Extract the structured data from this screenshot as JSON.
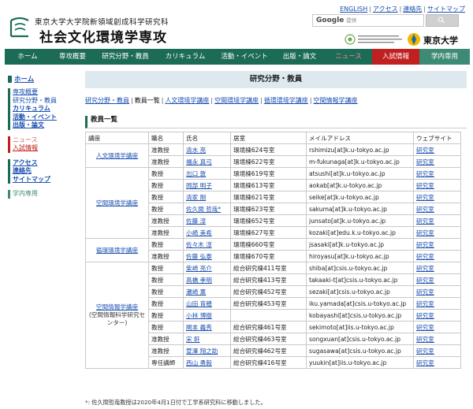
{
  "header": {
    "university": "東京大学大学院新領域創成科学研究科",
    "department": "社会文化環境学専攻",
    "top_links": [
      "ENGLISH",
      "アクセス",
      "連絡先",
      "サイトマップ"
    ],
    "search_brand": "Google",
    "search_sub": "提供",
    "ut_name": "東京大学"
  },
  "nav": {
    "items": [
      "ホーム",
      "専攻概要",
      "研究分野・教員",
      "カリキュラム",
      "活動・イベント",
      "出版・論文",
      "ニュース",
      "入試情報",
      "学内専用"
    ]
  },
  "sidebar": {
    "home": "ホーム",
    "group1": [
      "専攻概要",
      "研究分野・教員",
      "カリキュラム",
      "活動・イベント",
      "出版・論文"
    ],
    "group2": [
      "ニュース",
      "入試情報"
    ],
    "group3": [
      "アクセス",
      "連絡先",
      "サイトマップ"
    ],
    "group4": [
      "学内専用"
    ]
  },
  "main": {
    "title": "研究分野・教員",
    "breadcrumb": [
      "研究分野・教員",
      "教員一覧",
      "人文環境学講座",
      "空間環境学講座",
      "循環環境学講座",
      "空間情報学講座"
    ],
    "section": "教員一覧",
    "headers": [
      "講座",
      "職名",
      "氏名",
      "居室",
      "メイルアドレス",
      "ウェブサイト"
    ],
    "groups": [
      {
        "course": "人文環境学講座",
        "course_sub": "",
        "rows": [
          [
            "准教授",
            "清水 亮",
            "環境棟624号室",
            "rshimizu[at]k.u-tokyo.ac.jp",
            "研究室"
          ],
          [
            "准教授",
            "福永 真弓",
            "環境棟622号室",
            "m-fukunaga[at]k.u-tokyo.ac.jp",
            "研究室"
          ]
        ]
      },
      {
        "course": "空間環境学講座",
        "course_sub": "",
        "rows": [
          [
            "教授",
            "出口 敦",
            "環境棟619号室",
            "atsushi[at]k.u-tokyo.ac.jp",
            "研究室"
          ],
          [
            "教授",
            "岡部 明子",
            "環境棟613号室",
            "aokab[at]k.u-tokyo.ac.jp",
            "研究室"
          ],
          [
            "教授",
            "清家 剛",
            "環境棟621号室",
            "seike[at]k.u-tokyo.ac.jp",
            "研究室"
          ],
          [
            "教授",
            "佐久間 哲哉*",
            "環境棟623号室",
            "sakuma[at]k.u-tokyo.ac.jp",
            "研究室"
          ],
          [
            "准教授",
            "佐藤 淳",
            "環境棟652号室",
            "junsato[at]k.u-tokyo.ac.jp",
            "研究室"
          ],
          [
            "准教授",
            "小崎 美希",
            "環境棟627号室",
            "kozaki[at]edu.k.u-tokyo.ac.jp",
            "研究室"
          ]
        ]
      },
      {
        "course": "循環環境学講座",
        "course_sub": "",
        "rows": [
          [
            "教授",
            "佐々木 淳",
            "環境棟660号室",
            "jsasaki[at]k.u-tokyo.ac.jp",
            "研究室"
          ],
          [
            "准教授",
            "佐藤 弘泰",
            "環境棟670号室",
            "hiroyasu[at]k.u-tokyo.ac.jp",
            "研究室"
          ]
        ]
      },
      {
        "course": "空間情報学講座",
        "course_sub": "(空間情報科学研究センター)",
        "rows": [
          [
            "教授",
            "柴崎 亮介",
            "総合研究棟411号室",
            "shiba[at]csis.u-tokyo.ac.jp",
            "研究室"
          ],
          [
            "教授",
            "高橋 孝明",
            "総合研究棟413号室",
            "takaaki-t[at]csis.u-tokyo.ac.jp",
            "研究室"
          ],
          [
            "教授",
            "瀬崎 薫",
            "総合研究棟452号室",
            "sezaki[at]csis.u-tokyo.ac.jp",
            "研究室"
          ],
          [
            "教授",
            "山田 育穂",
            "総合研究棟453号室",
            "iku.yamada[at]csis.u-tokyo.ac.jp",
            "研究室"
          ],
          [
            "教授",
            "小林 博樹",
            "",
            "kobayashi[at]csis.u-tokyo.ac.jp",
            "研究室"
          ],
          [
            "教授",
            "関本 義秀",
            "総合研究棟461号室",
            "sekimoto[at]iis.u-tokyo.ac.jp",
            "研究室"
          ],
          [
            "准教授",
            "宋 軒",
            "総合研究棟463号室",
            "songxuan[at]csis.u-tokyo.ac.jp",
            "研究室"
          ],
          [
            "准教授",
            "菅澤 翔之助",
            "総合研究棟462号室",
            "sugasawa[at]csis.u-tokyo.ac.jp",
            "研究室"
          ],
          [
            "専任講師",
            "西山 勇毅",
            "総合研究棟416号室",
            "yuukin[at]iis.u-tokyo.ac.jp",
            "研究室"
          ]
        ]
      }
    ],
    "note": "*: 佐久間哲哉教授は2020年4月1日付で工学系研究科に移動しました。"
  }
}
